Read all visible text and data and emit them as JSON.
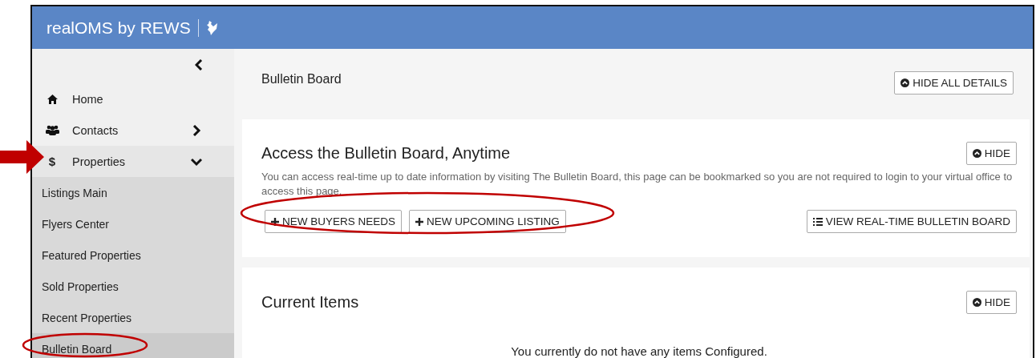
{
  "header": {
    "title": "realOMS by REWS"
  },
  "sidebar": {
    "items": [
      {
        "label": "Home",
        "kind": "home"
      },
      {
        "label": "Contacts",
        "kind": "contacts",
        "expanded": false
      },
      {
        "label": "Properties",
        "kind": "properties",
        "symbol": "$",
        "expanded": true,
        "children": [
          {
            "label": "Listings Main",
            "selected": false
          },
          {
            "label": "Flyers Center",
            "selected": false
          },
          {
            "label": "Featured Properties",
            "selected": false
          },
          {
            "label": "Sold Properties",
            "selected": false
          },
          {
            "label": "Recent Properties",
            "selected": false
          },
          {
            "label": "Bulletin Board",
            "selected": true
          }
        ]
      }
    ]
  },
  "page": {
    "title": "Bulletin Board",
    "button": "HIDE ALL DETAILS"
  },
  "cards": [
    {
      "title": "Access the Bulletin Board, Anytime",
      "hide": "HIDE",
      "text": "You can access real-time up to date information by visiting The Bulletin Board, this page can be bookmarked so you are not required to login to your virtual office to access this page.",
      "actions": [
        "NEW BUYERS NEEDS",
        "NEW UPCOMING LISTING"
      ],
      "view": "VIEW REAL-TIME BULLETIN BOARD"
    },
    {
      "title": "Current Items",
      "hide": "HIDE",
      "empty": "You currently do not have any items Configured."
    }
  ]
}
